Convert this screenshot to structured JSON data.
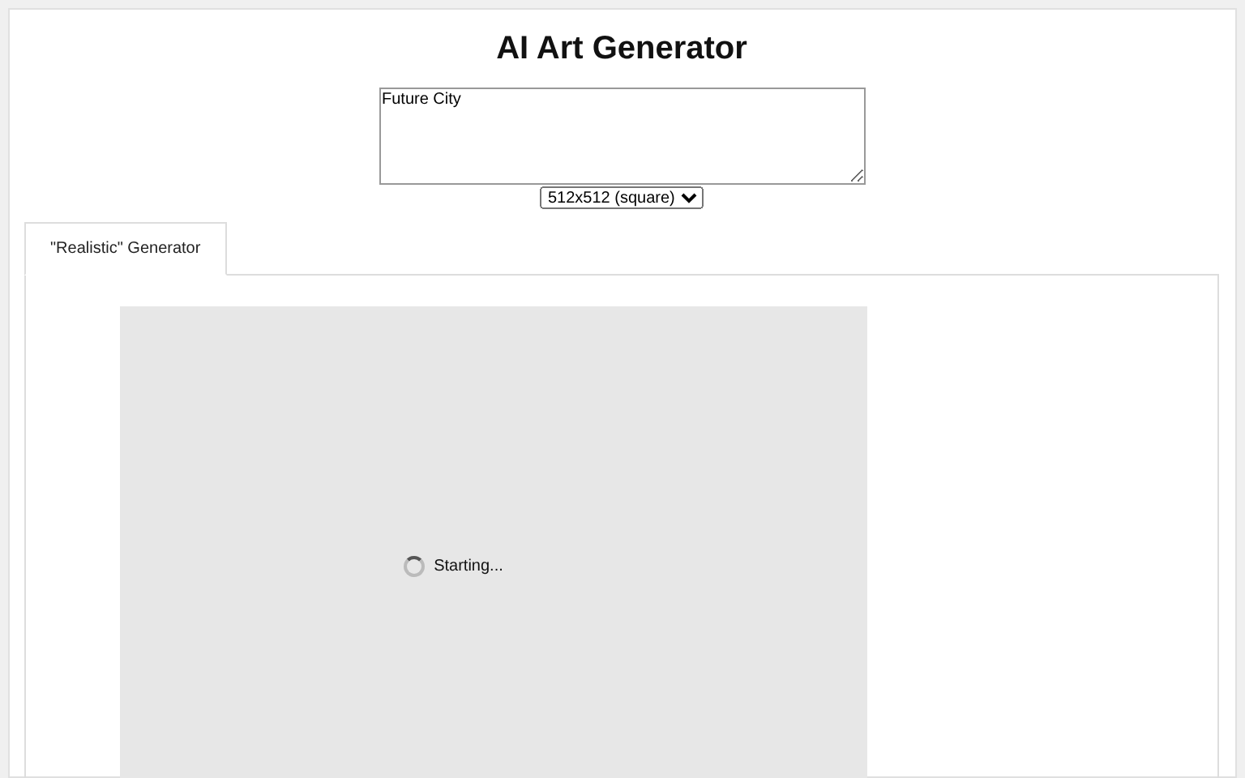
{
  "title": "AI Art Generator",
  "prompt": {
    "value": "Future City"
  },
  "size_select": {
    "value": "512x512 (square)"
  },
  "tabs": [
    {
      "label": "\"Realistic\" Generator",
      "selected": true
    }
  ],
  "output": {
    "status": "Starting...",
    "loading": true
  }
}
